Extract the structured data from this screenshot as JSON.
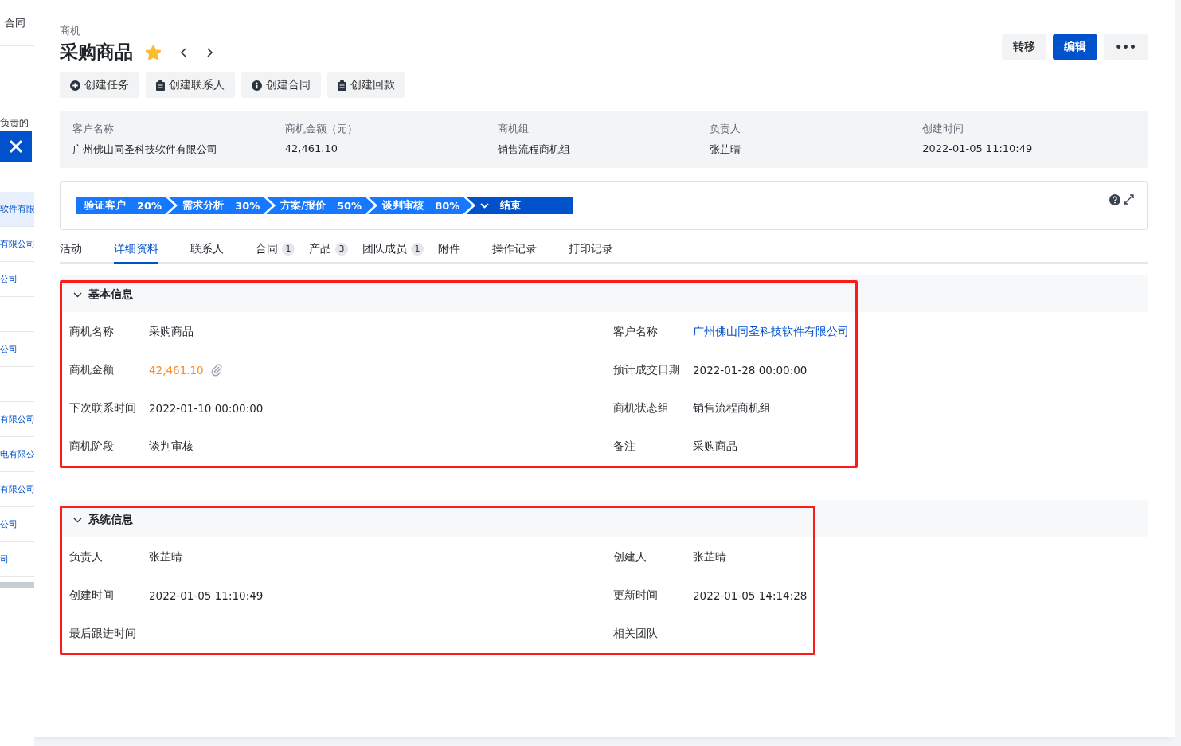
{
  "background_list": {
    "header": "合同",
    "caption": "负责的",
    "rows": [
      {
        "text": "软件有限",
        "selected": true
      },
      {
        "text": "有限公司",
        "selected": false
      },
      {
        "text": "公司",
        "selected": false
      },
      {
        "text": "",
        "selected": false
      },
      {
        "text": "公司",
        "selected": false
      },
      {
        "text": "",
        "selected": false
      },
      {
        "text": "有限公司",
        "selected": false
      },
      {
        "text": "电有限公",
        "selected": false
      },
      {
        "text": "有限公司",
        "selected": false
      },
      {
        "text": "公司",
        "selected": false
      },
      {
        "text": "司",
        "selected": false
      }
    ]
  },
  "breadcrumb": "商机",
  "title": "采购商品",
  "starred": true,
  "header_buttons": [
    {
      "label": "转移",
      "kind": "plain"
    },
    {
      "label": "编辑",
      "kind": "primary"
    },
    {
      "label": "•••",
      "kind": "more"
    }
  ],
  "actions": [
    {
      "label": "创建任务",
      "kind": "plus"
    },
    {
      "label": "创建联系人",
      "kind": "clipboard"
    },
    {
      "label": "创建合同",
      "kind": "info"
    },
    {
      "label": "创建回款",
      "kind": "clipboard"
    }
  ],
  "summary": [
    {
      "label": "客户名称",
      "value": "广州佛山同圣科技软件有限公司"
    },
    {
      "label": "商机金额（元）",
      "value": "42,461.10"
    },
    {
      "label": "商机组",
      "value": "销售流程商机组"
    },
    {
      "label": "负责人",
      "value": "张芷晴"
    },
    {
      "label": "创建时间",
      "value": "2022-01-05 11:10:49"
    }
  ],
  "stages": [
    {
      "name": "验证客户",
      "percent": "20%",
      "kind": "step",
      "selected": false
    },
    {
      "name": "需求分析",
      "percent": "30%",
      "kind": "step",
      "selected": false
    },
    {
      "name": "方案/报价",
      "percent": "50%",
      "kind": "step",
      "selected": false
    },
    {
      "name": "谈判审核",
      "percent": "80%",
      "kind": "step",
      "selected": false
    },
    {
      "name": "结束",
      "kind": "end",
      "selected": true
    }
  ],
  "tabs": [
    {
      "label": "活动",
      "selected": false
    },
    {
      "label": "详细资料",
      "selected": true
    },
    {
      "label": "联系人",
      "selected": false
    },
    {
      "label": "合同",
      "count": "1",
      "selected": false
    },
    {
      "label": "产品",
      "count": "3",
      "selected": false
    },
    {
      "label": "团队成员",
      "count": "1",
      "selected": false
    },
    {
      "label": "附件",
      "selected": false
    },
    {
      "label": "操作记录",
      "selected": false
    },
    {
      "label": "打印记录",
      "selected": false
    }
  ],
  "sections": [
    {
      "title": "基本信息",
      "expanded": true,
      "highlighted": true,
      "fields": [
        {
          "label": "商机名称",
          "value": "采购商品",
          "kind": "text"
        },
        {
          "label": "客户名称",
          "value": "广州佛山同圣科技软件有限公司",
          "kind": "link"
        },
        {
          "label": "商机金额",
          "value": "42,461.10",
          "kind": "amount"
        },
        {
          "label": "预计成交日期",
          "value": "2022-01-28 00:00:00",
          "kind": "text"
        },
        {
          "label": "下次联系时间",
          "value": "2022-01-10 00:00:00",
          "kind": "text"
        },
        {
          "label": "商机状态组",
          "value": "销售流程商机组",
          "kind": "text"
        },
        {
          "label": "商机阶段",
          "value": "谈判审核",
          "kind": "text"
        },
        {
          "label": "备注",
          "value": "采购商品",
          "kind": "text"
        }
      ]
    },
    {
      "title": "系统信息",
      "expanded": true,
      "highlighted": true,
      "fields": [
        {
          "label": "负责人",
          "value": "张芷晴",
          "kind": "text"
        },
        {
          "label": "创建人",
          "value": "张芷晴",
          "kind": "text"
        },
        {
          "label": "创建时间",
          "value": "2022-01-05 11:10:49",
          "kind": "text"
        },
        {
          "label": "更新时间",
          "value": "2022-01-05 14:14:28",
          "kind": "text"
        },
        {
          "label": "最后跟进时间",
          "kind": "text"
        },
        {
          "label": "相关团队",
          "kind": "text"
        }
      ]
    }
  ]
}
